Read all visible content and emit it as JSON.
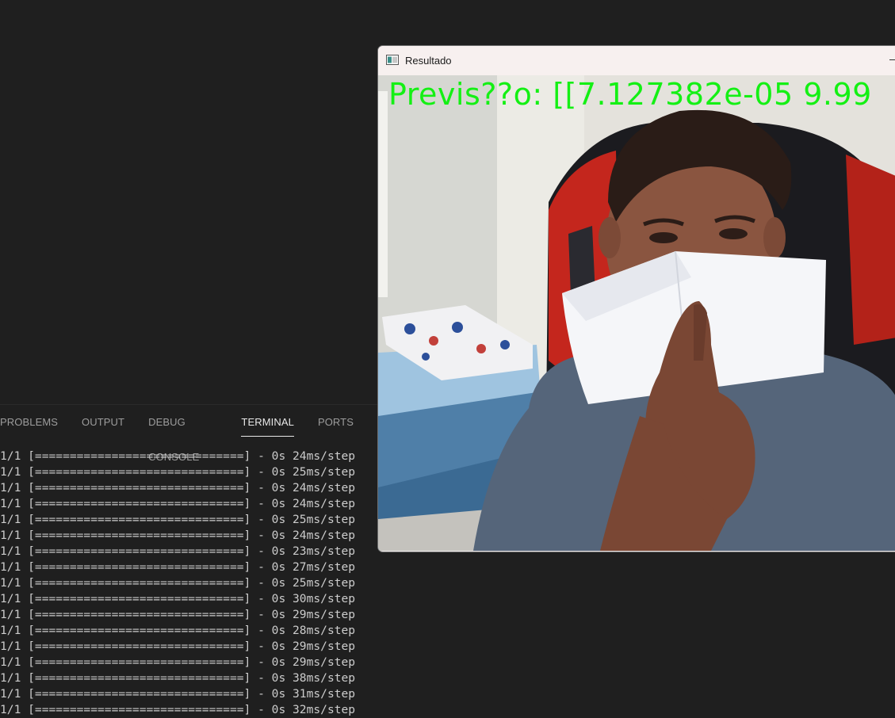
{
  "panel": {
    "tabs": [
      {
        "label": "PROBLEMS",
        "active": false
      },
      {
        "label": "OUTPUT",
        "active": false
      },
      {
        "label": "DEBUG CONSOLE",
        "active": false
      },
      {
        "label": "TERMINAL",
        "active": true
      },
      {
        "label": "PORTS",
        "active": false
      }
    ]
  },
  "terminal": {
    "lines": [
      "1/1 [==============================] - 0s 24ms/step",
      "1/1 [==============================] - 0s 25ms/step",
      "1/1 [==============================] - 0s 24ms/step",
      "1/1 [==============================] - 0s 24ms/step",
      "1/1 [==============================] - 0s 25ms/step",
      "1/1 [==============================] - 0s 24ms/step",
      "1/1 [==============================] - 0s 23ms/step",
      "1/1 [==============================] - 0s 27ms/step",
      "1/1 [==============================] - 0s 25ms/step",
      "1/1 [==============================] - 0s 30ms/step",
      "1/1 [==============================] - 0s 29ms/step",
      "1/1 [==============================] - 0s 28ms/step",
      "1/1 [==============================] - 0s 29ms/step",
      "1/1 [==============================] - 0s 29ms/step",
      "1/1 [==============================] - 0s 38ms/step",
      "1/1 [==============================] - 0s 31ms/step",
      "1/1 [==============================] - 0s 32ms/step"
    ]
  },
  "window": {
    "title": "Resultado",
    "overlay_text": "Previs??o: [[7.127382e-05 9.99",
    "overlay_color": "#14f014"
  }
}
